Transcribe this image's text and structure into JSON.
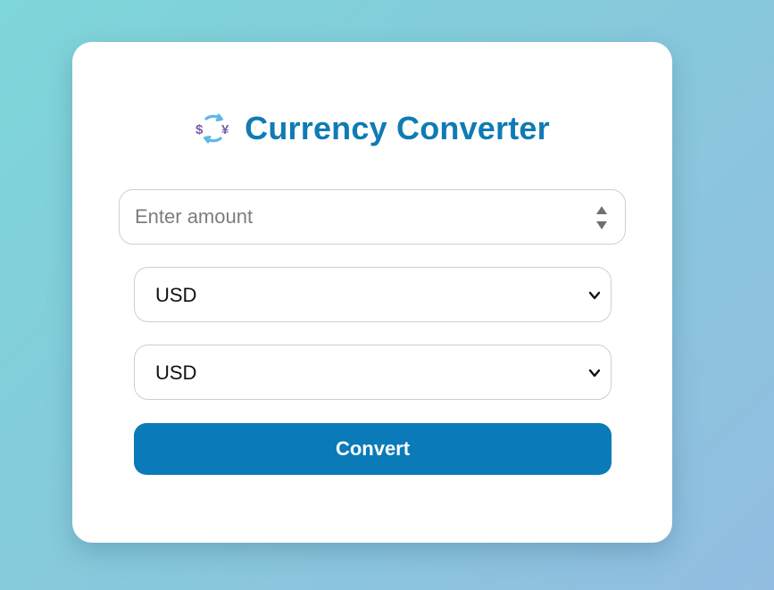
{
  "header": {
    "icon": "currency-exchange-icon",
    "title": "Currency Converter"
  },
  "amount": {
    "value": "",
    "placeholder": "Enter amount"
  },
  "from_currency": {
    "selected": "USD"
  },
  "to_currency": {
    "selected": "USD"
  },
  "convert_button": {
    "label": "Convert"
  },
  "colors": {
    "accent": "#0a7ab8",
    "title": "#0f7bb5",
    "background_start": "#7dd6d9",
    "background_end": "#92bde0"
  }
}
